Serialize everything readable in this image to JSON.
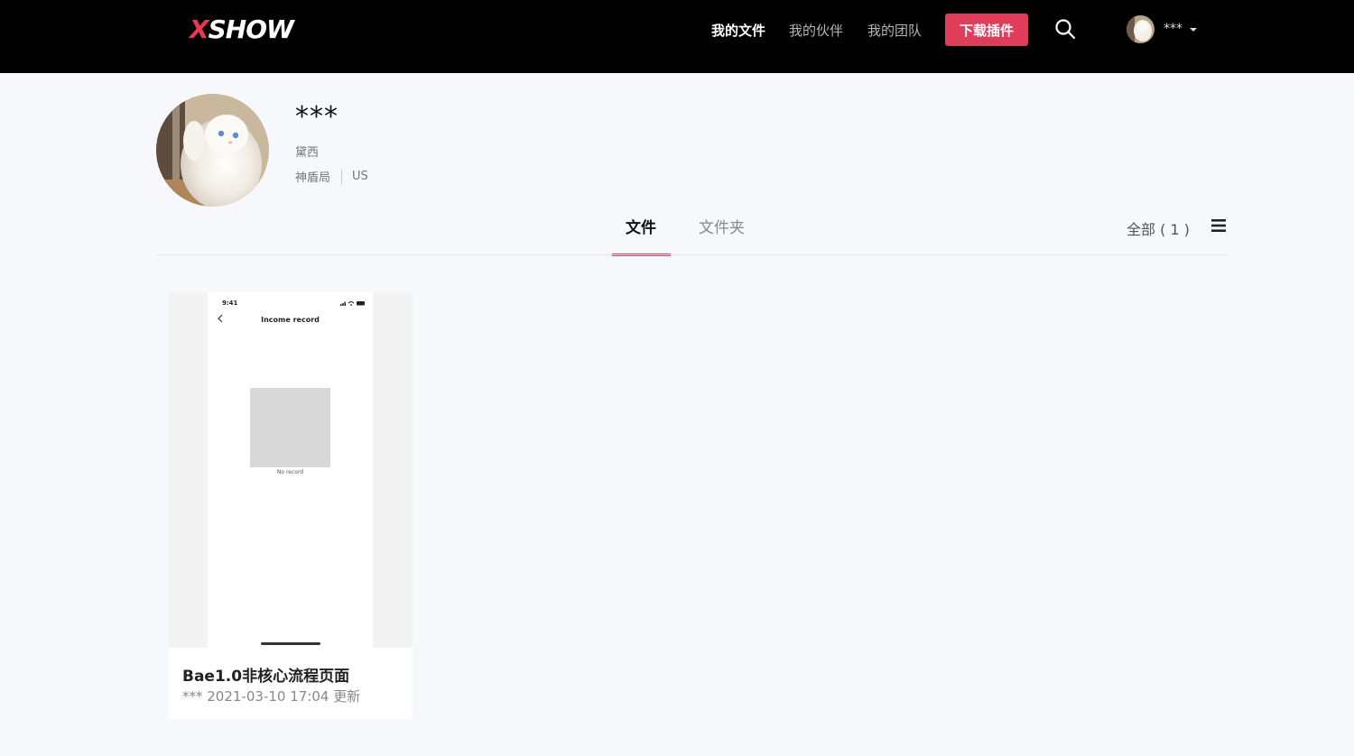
{
  "brand": {
    "logo_x": "X",
    "logo_rest": "SHOW"
  },
  "nav": {
    "my_files": "我的文件",
    "my_partners": "我的伙伴",
    "my_team": "我的团队",
    "download_plugin": "下载插件"
  },
  "user": {
    "name": "***"
  },
  "profile": {
    "name": "***",
    "subtitle": "黛西",
    "org": "神盾局",
    "region": "US"
  },
  "tabs": [
    {
      "label": "文件",
      "active": true
    },
    {
      "label": "文件夹",
      "active": false
    }
  ],
  "filter": {
    "label": "全部 ( 1 )"
  },
  "files": [
    {
      "title": "Bae1.0非核心流程页面",
      "meta": "*** 2021-03-10 17:04 更新",
      "preview": {
        "time": "9:41",
        "screen_title": "Income record",
        "empty_text": "No record"
      }
    }
  ],
  "colors": {
    "accent": "#e03d5a",
    "topbar": "#000000",
    "background": "#f7f8fb"
  },
  "icons": [
    "search-icon",
    "caret-down-icon",
    "list-view-icon",
    "back-arrow-icon"
  ]
}
